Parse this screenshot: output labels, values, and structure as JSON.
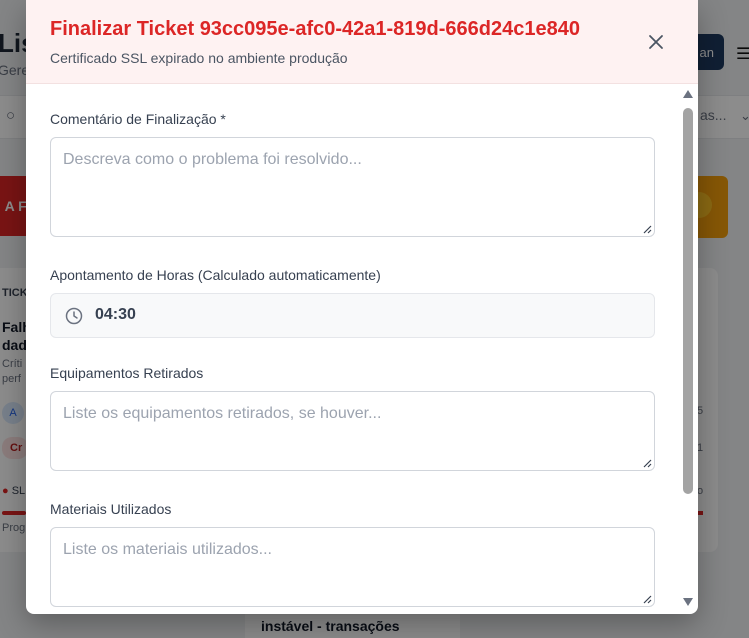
{
  "background": {
    "page_title": "Lis",
    "page_subtitle": "Gere",
    "action_button": "an",
    "filter_text": "as...",
    "banner_text": "A FA",
    "card_header": "TICK",
    "card_title_line1": "Falh",
    "card_title_line2": "dad",
    "card_desc_line1": "Críti",
    "card_desc_line2": "perf",
    "avatar_initial": "A",
    "badge_text": "Cr",
    "sla_text": "SL",
    "progress_label": "Prog",
    "card2_title": "instável - transações",
    "right_num1": "5",
    "right_num2": "1",
    "right_num3": "o"
  },
  "modal": {
    "title": "Finalizar Ticket 93cc095e-afc0-42a1-819d-666d24c1e840",
    "subtitle": "Certificado SSL expirado no ambiente produção",
    "fields": {
      "comment_label": "Comentário de Finalização *",
      "comment_placeholder": "Descreva como o problema foi resolvido...",
      "hours_label": "Apontamento de Horas (Calculado automaticamente)",
      "hours_value": "04:30",
      "equipment_label": "Equipamentos Retirados",
      "equipment_placeholder": "Liste os equipamentos retirados, se houver...",
      "materials_label": "Materiais Utilizados",
      "materials_placeholder": "Liste os materiais utilizados..."
    }
  },
  "colors": {
    "title_red": "#dc2626",
    "header_bg": "#fef2f2"
  },
  "icons": {
    "close": "close-icon",
    "clock": "clock-icon"
  }
}
